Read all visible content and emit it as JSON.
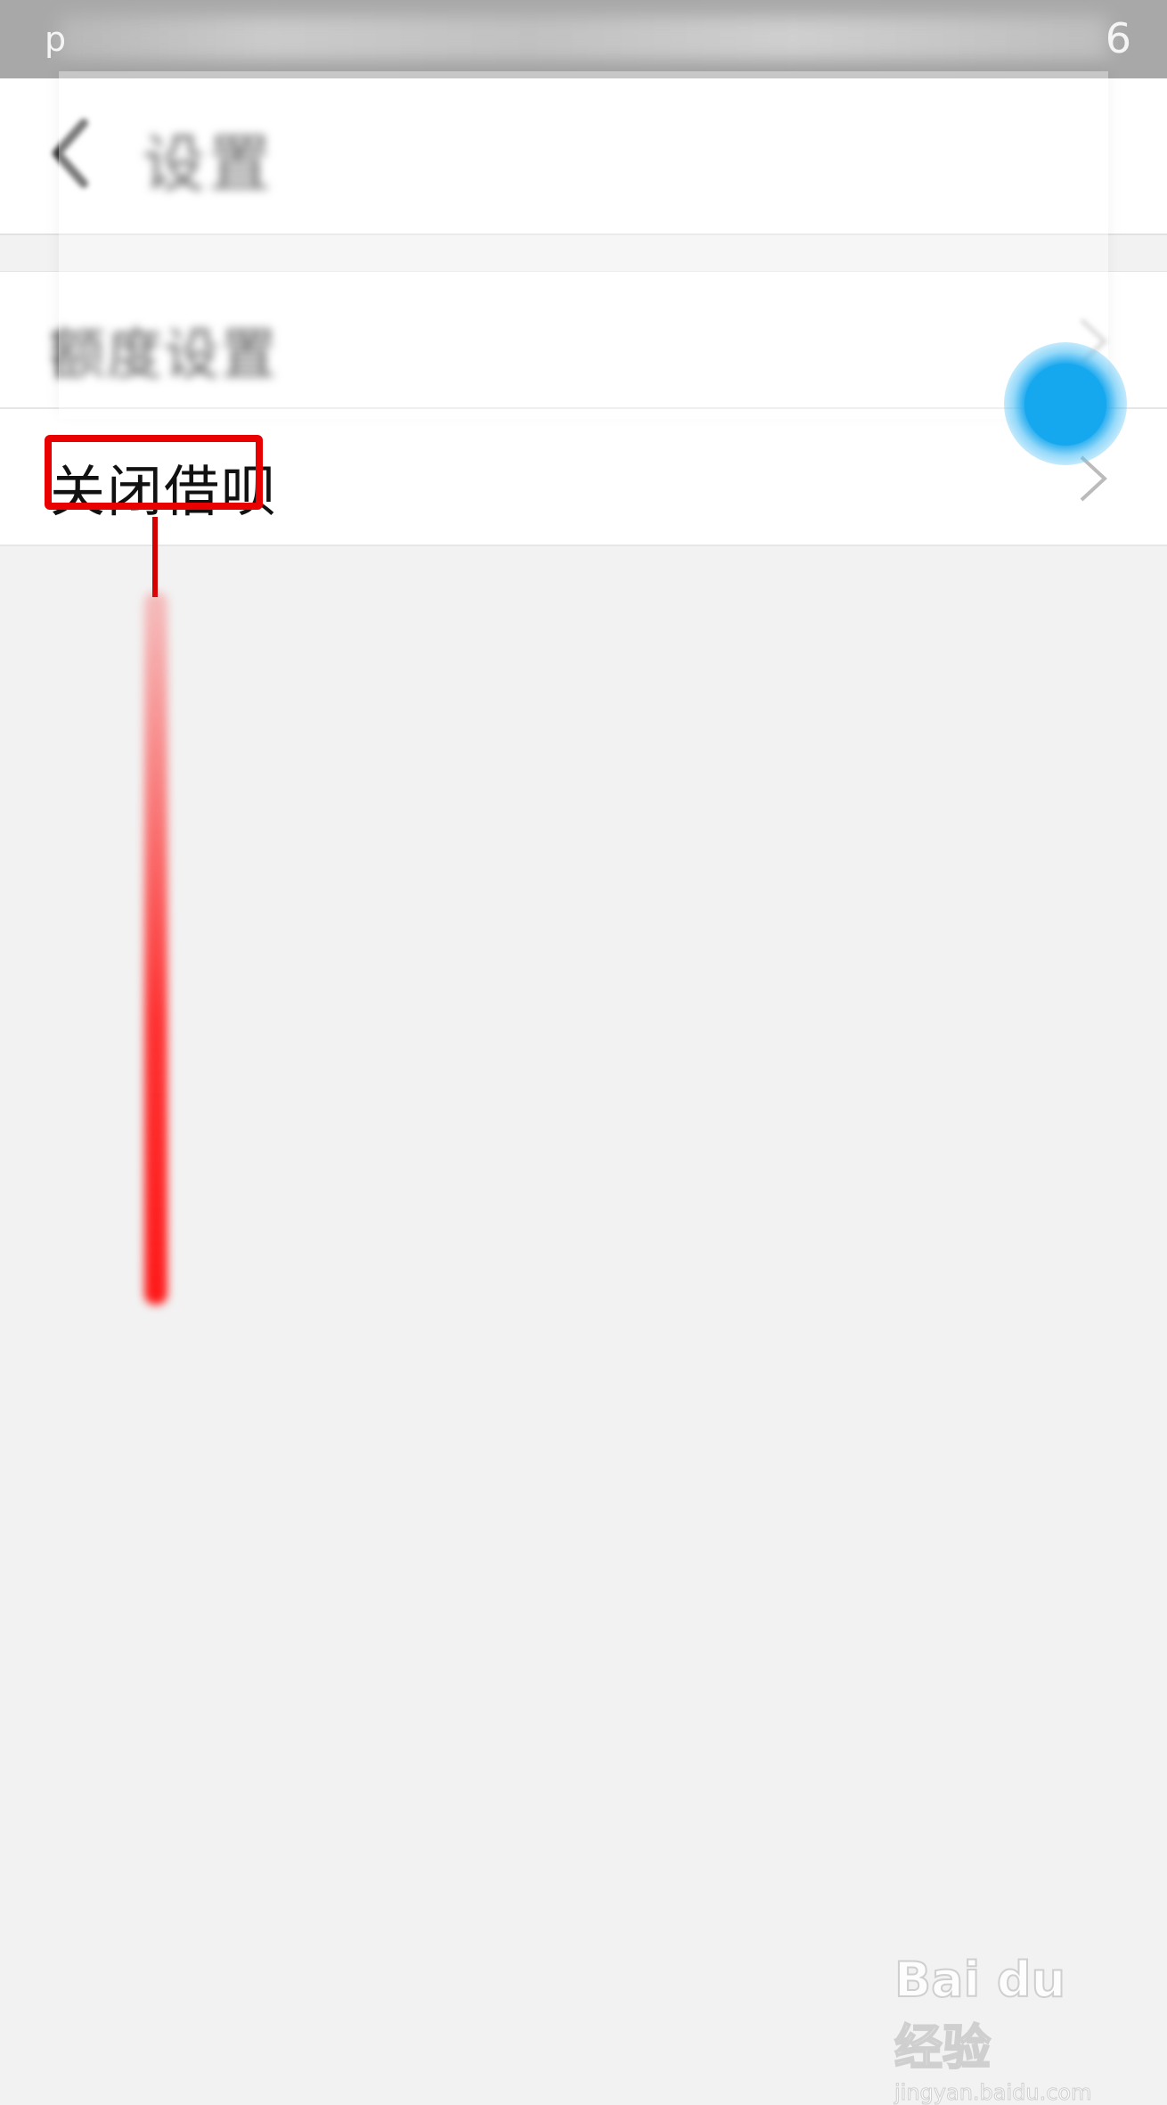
{
  "status_bar": {
    "left_char": "p",
    "time_fragment": "6"
  },
  "header": {
    "title": "设置",
    "back_icon": "chevron-left-icon"
  },
  "list": {
    "items": [
      {
        "label": "额度设置",
        "chevron_icon": "chevron-right-icon"
      },
      {
        "label": "关闭借呗",
        "chevron_icon": "chevron-right-icon"
      }
    ]
  },
  "annotation": {
    "highlight_color": "#e90000",
    "touch_color": "#16a8ee"
  },
  "watermark": {
    "logo": "Bai du 经验",
    "url": "jingyan.baidu.com"
  }
}
